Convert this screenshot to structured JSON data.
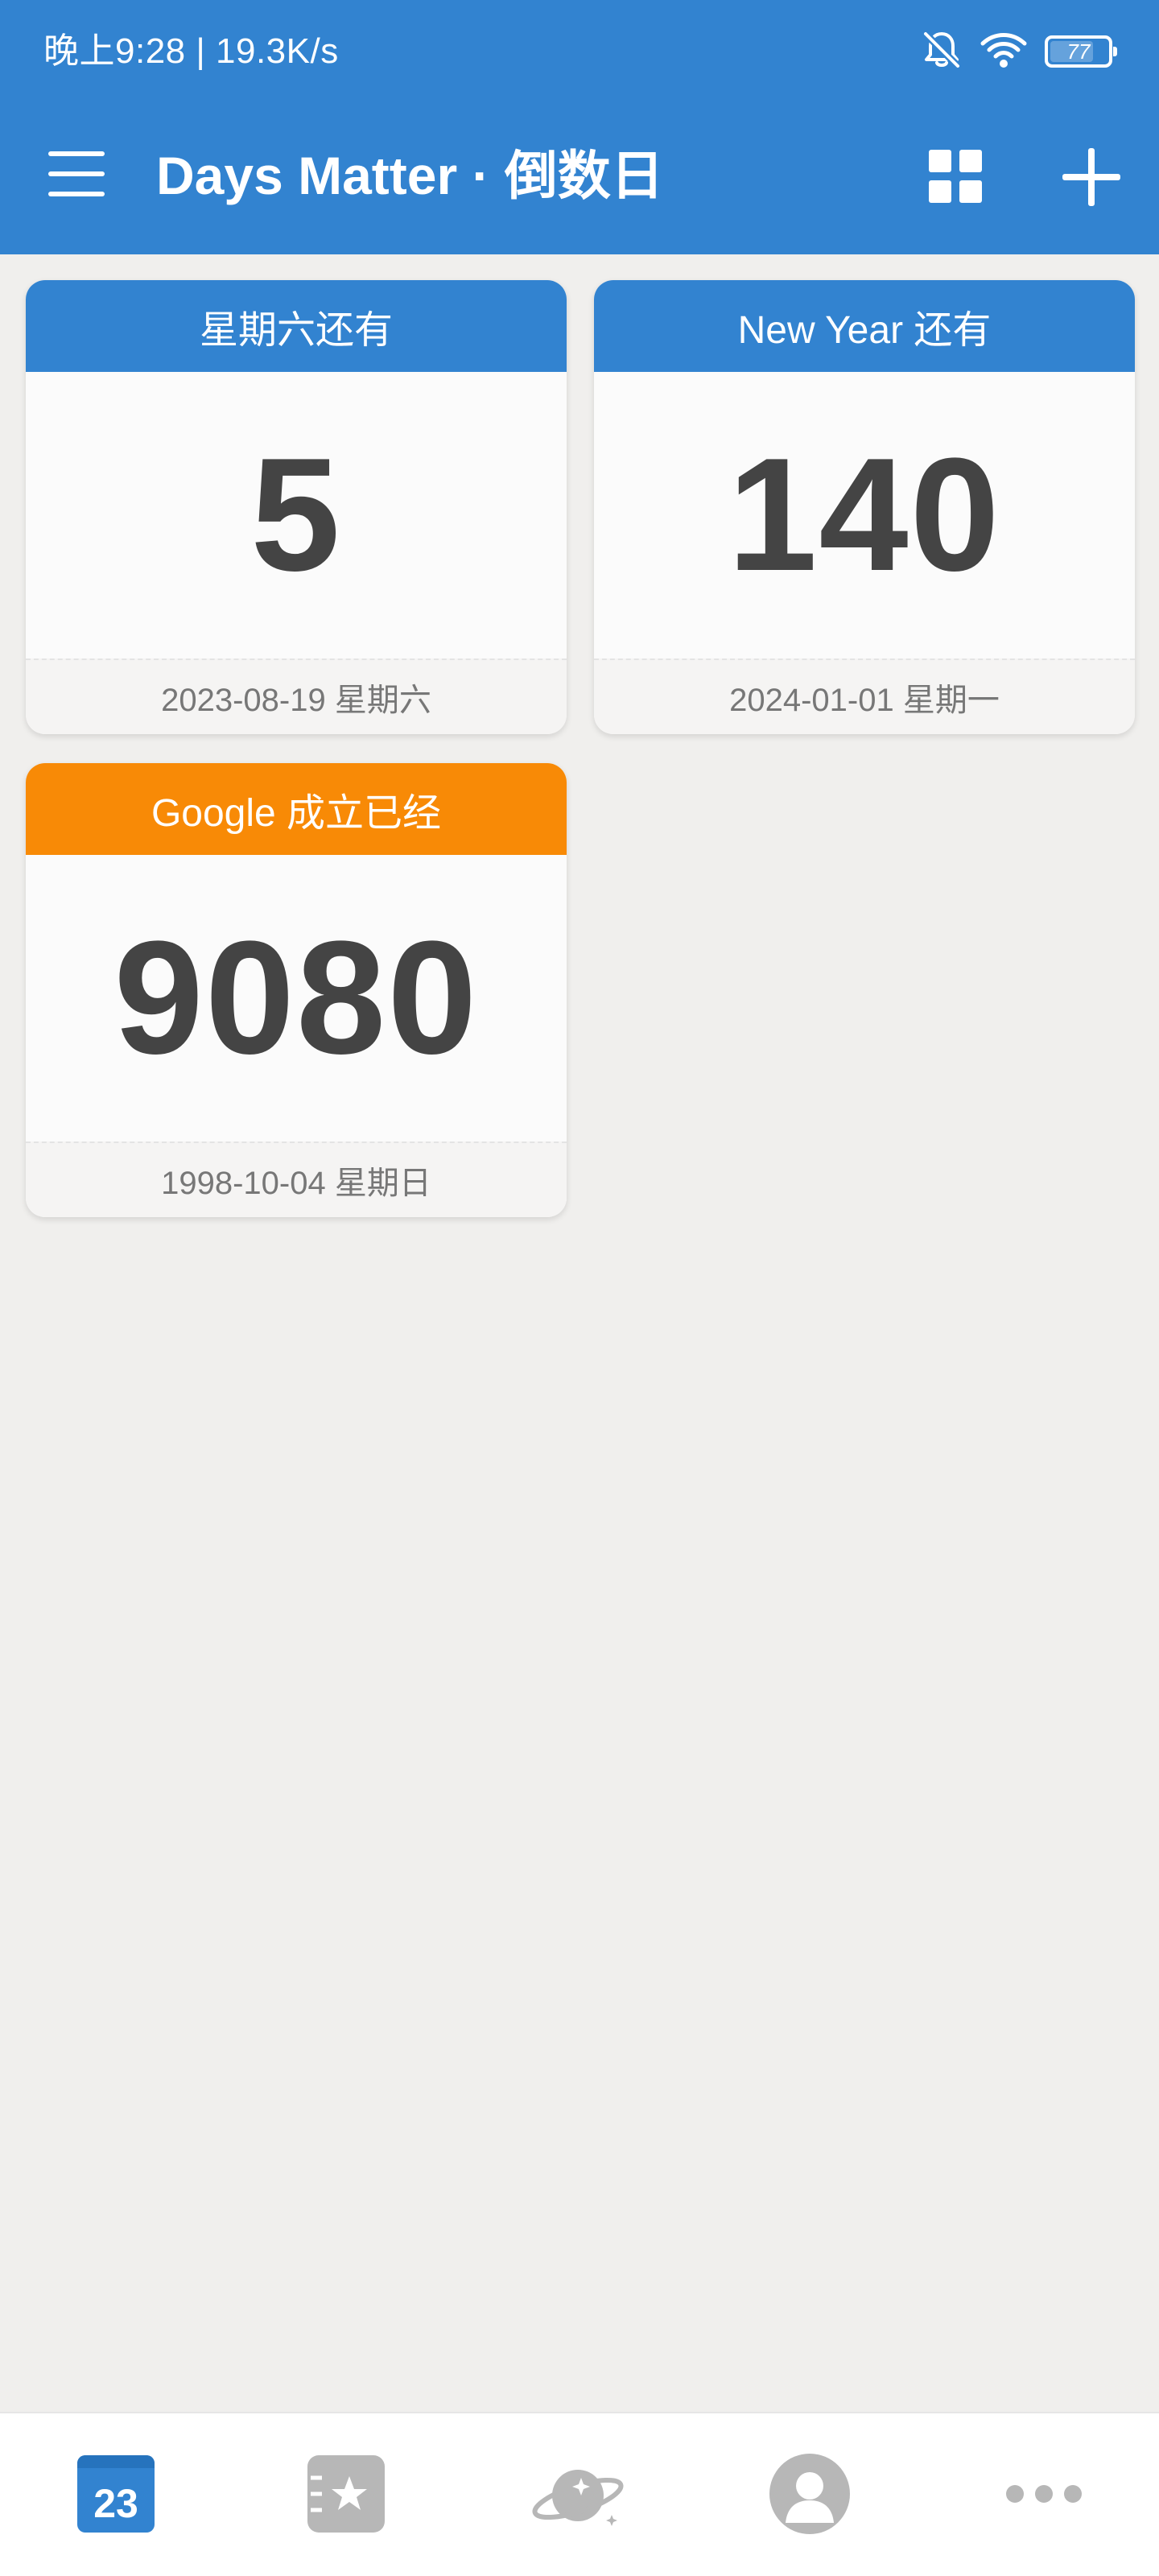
{
  "status_bar": {
    "time_speed": "晚上9:28 | 19.3K/s",
    "battery": "77",
    "battery_level_percent": 77,
    "icons": [
      "bell-off-icon",
      "wifi-icon",
      "battery-icon"
    ]
  },
  "app_bar": {
    "title": "Days Matter · 倒数日",
    "icons": [
      "menu-icon",
      "grid-view-icon",
      "add-icon"
    ]
  },
  "cards": [
    {
      "title": "星期六还有",
      "days": "5",
      "date": "2023-08-19 星期六",
      "color": "#3283d0"
    },
    {
      "title": "New Year 还有",
      "days": "140",
      "date": "2024-01-01 星期一",
      "color": "#3283d0"
    },
    {
      "title": "Google 成立已经",
      "days": "9080",
      "date": "1998-10-04 星期日",
      "color": "#f88a06"
    }
  ],
  "bottom_nav": {
    "calendar_day": "23",
    "items": [
      "calendar-tab-icon",
      "favorites-tab-icon",
      "discover-planet-tab-icon",
      "profile-tab-icon",
      "more-tab-icon"
    ],
    "active_color": "#3283d0",
    "inactive_color": "#b7b7b7"
  }
}
